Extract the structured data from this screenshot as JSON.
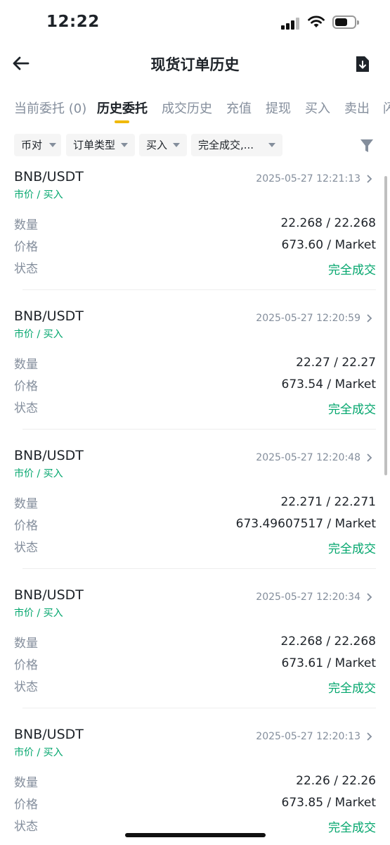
{
  "status_bar": {
    "time": "12:22"
  },
  "header": {
    "title": "现货订单历史",
    "back_icon": "arrow-left-icon",
    "download_icon": "download-icon"
  },
  "tabs": [
    {
      "label": "当前委托 (0)",
      "active": false
    },
    {
      "label": "历史委托",
      "active": true
    },
    {
      "label": "成交历史",
      "active": false
    },
    {
      "label": "充值",
      "active": false
    },
    {
      "label": "提现",
      "active": false
    },
    {
      "label": "买入",
      "active": false
    },
    {
      "label": "卖出",
      "active": false
    },
    {
      "label": "闪",
      "active": false
    }
  ],
  "filters": [
    {
      "label": "币对"
    },
    {
      "label": "订单类型"
    },
    {
      "label": "买入"
    },
    {
      "label": "完全成交,..."
    }
  ],
  "field_labels": {
    "quantity": "数量",
    "price": "价格",
    "status": "状态"
  },
  "orders": [
    {
      "pair": "BNB/USDT",
      "type": "市价 / 买入",
      "time": "2025-05-27 12:21:13",
      "quantity": "22.268 / 22.268",
      "price": "673.60 / Market",
      "status": "完全成交"
    },
    {
      "pair": "BNB/USDT",
      "type": "市价 / 买入",
      "time": "2025-05-27 12:20:59",
      "quantity": "22.27 / 22.27",
      "price": "673.54 / Market",
      "status": "完全成交"
    },
    {
      "pair": "BNB/USDT",
      "type": "市价 / 买入",
      "time": "2025-05-27 12:20:48",
      "quantity": "22.271 / 22.271",
      "price": "673.49607517 / Market",
      "status": "完全成交"
    },
    {
      "pair": "BNB/USDT",
      "type": "市价 / 买入",
      "time": "2025-05-27 12:20:34",
      "quantity": "22.268 / 22.268",
      "price": "673.61 / Market",
      "status": "完全成交"
    },
    {
      "pair": "BNB/USDT",
      "type": "市价 / 买入",
      "time": "2025-05-27 12:20:13",
      "quantity": "22.26 / 22.26",
      "price": "673.85 / Market",
      "status": "完全成交"
    }
  ],
  "colors": {
    "accent": "#f0b90b",
    "buy_green": "#03a66d",
    "muted": "#848e9c",
    "text": "#1e2329"
  }
}
